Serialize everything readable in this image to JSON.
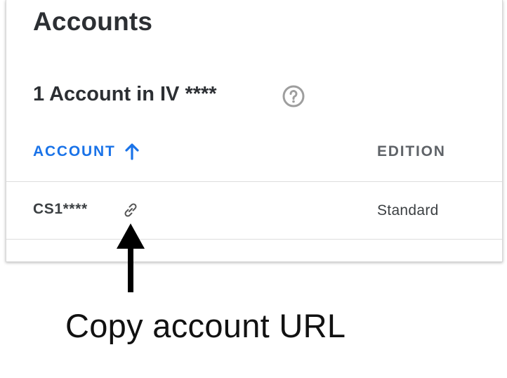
{
  "header": {
    "title": "Accounts"
  },
  "section": {
    "title": "1 Account in IV ****",
    "help_icon": "question-circle-icon"
  },
  "table": {
    "columns": [
      {
        "label": "ACCOUNT",
        "sort": "ascending",
        "color": "#1a73e8"
      },
      {
        "label": "EDITION"
      }
    ],
    "rows": [
      {
        "account": "CS1****",
        "edition": "Standard",
        "action_icon": "link-icon"
      }
    ]
  },
  "annotation": {
    "text": "Copy account URL"
  }
}
